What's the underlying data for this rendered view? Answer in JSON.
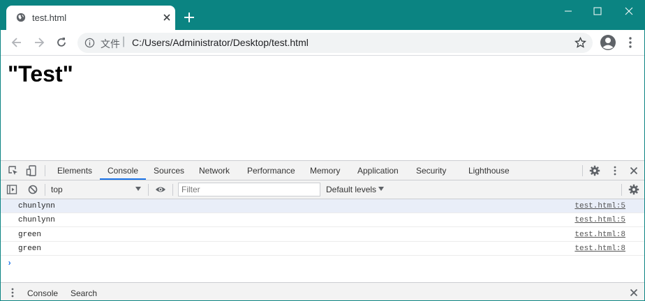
{
  "browser": {
    "tab_title": "test.html",
    "url_scheme": "文件",
    "url_separator": "|",
    "url_path": "C:/Users/Administrator/Desktop/test.html",
    "frame_color": "#0b8482"
  },
  "page": {
    "heading": "\"Test\""
  },
  "devtools": {
    "tabs": [
      "Elements",
      "Console",
      "Sources",
      "Network",
      "Performance",
      "Memory",
      "Application",
      "Security",
      "Lighthouse"
    ],
    "active_tab": "Console",
    "context": "top",
    "filter_placeholder": "Filter",
    "levels_label": "Default levels",
    "logs": [
      {
        "message": "chunlynn",
        "source": "test.html:5",
        "selected": true
      },
      {
        "message": "chunlynn",
        "source": "test.html:5",
        "selected": false
      },
      {
        "message": "green",
        "source": "test.html:8",
        "selected": false
      },
      {
        "message": "green",
        "source": "test.html:8",
        "selected": false
      }
    ],
    "prompt": "›",
    "drawer_tabs": [
      "Console",
      "Search"
    ],
    "accent": "#1a73e8"
  }
}
